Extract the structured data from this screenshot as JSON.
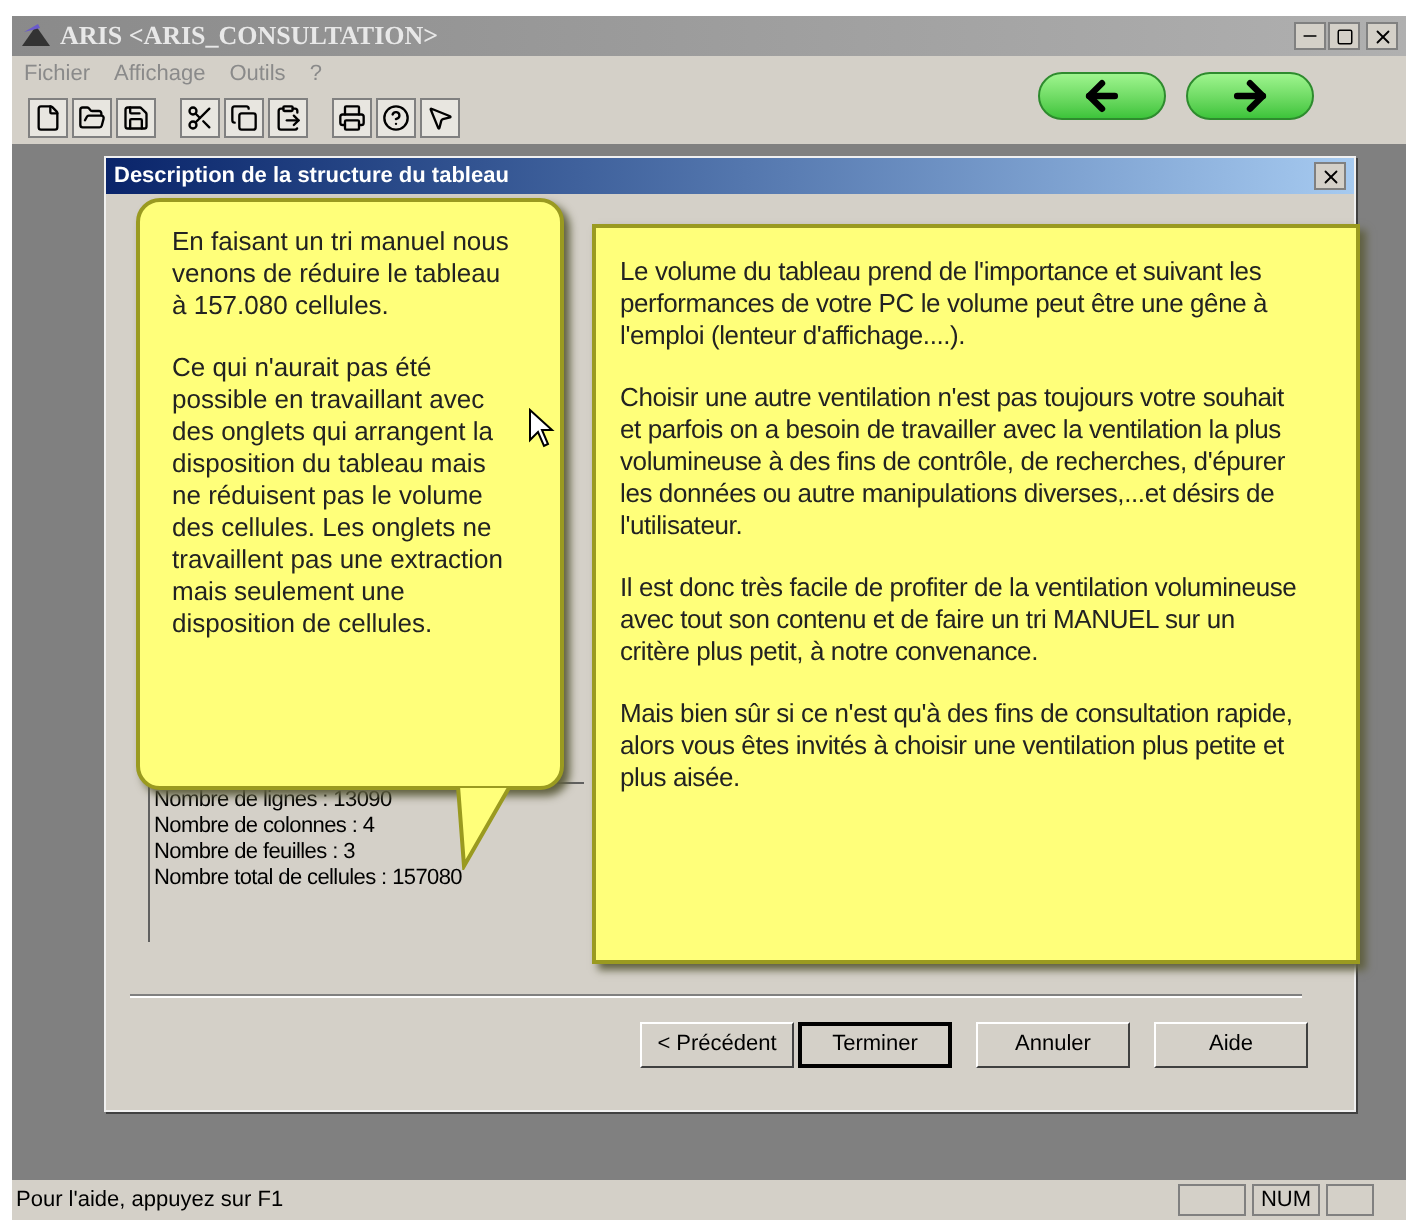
{
  "window": {
    "title": "ARIS <ARIS_CONSULTATION>"
  },
  "menu": [
    "Fichier",
    "Affichage",
    "Outils",
    "?"
  ],
  "dialog": {
    "title": "Description de la structure du tableau",
    "info_lines": [
      "Nombre de lignes : 13090",
      "Nombre de colonnes : 4",
      "Nombre de feuilles : 3",
      "Nombre total de cellules : 157080"
    ],
    "buttons": [
      {
        "label": "< Précédent",
        "default": false
      },
      {
        "label": "Terminer",
        "default": true
      },
      {
        "label": "Annuler",
        "default": false
      },
      {
        "label": "Aide",
        "default": false
      }
    ]
  },
  "callout_left": [
    "En faisant un tri manuel nous venons de réduire le tableau à 157.080 cellules.",
    "Ce qui n'aurait pas été possible en travaillant avec des onglets qui arrangent la disposition du tableau mais ne réduisent pas le volume des cellules. Les onglets ne travaillent pas une extraction mais seulement une disposition de cellules."
  ],
  "callout_right": [
    "Le volume du tableau prend de l'importance et suivant les performances de votre PC le volume peut être une gêne à l'emploi (lenteur d'affichage....).",
    "Choisir une autre ventilation n'est pas toujours votre souhait et parfois on a besoin de travailler avec la ventilation la plus volumineuse à des fins de contrôle, de recherches, d'épurer les données ou autre manipulations diverses,...et désirs de l'utilisateur.",
    "Il est donc très facile de profiter de la ventilation volumineuse avec tout son contenu et de faire un tri MANUEL sur un critère plus petit, à notre convenance.",
    "Mais bien sûr si ce n'est qu'à des fins de consultation rapide, alors vous êtes invités à choisir une ventilation plus petite et plus aisée."
  ],
  "status_bar": {
    "text": "Pour l'aide, appuyez sur F1",
    "indicator": "NUM"
  }
}
